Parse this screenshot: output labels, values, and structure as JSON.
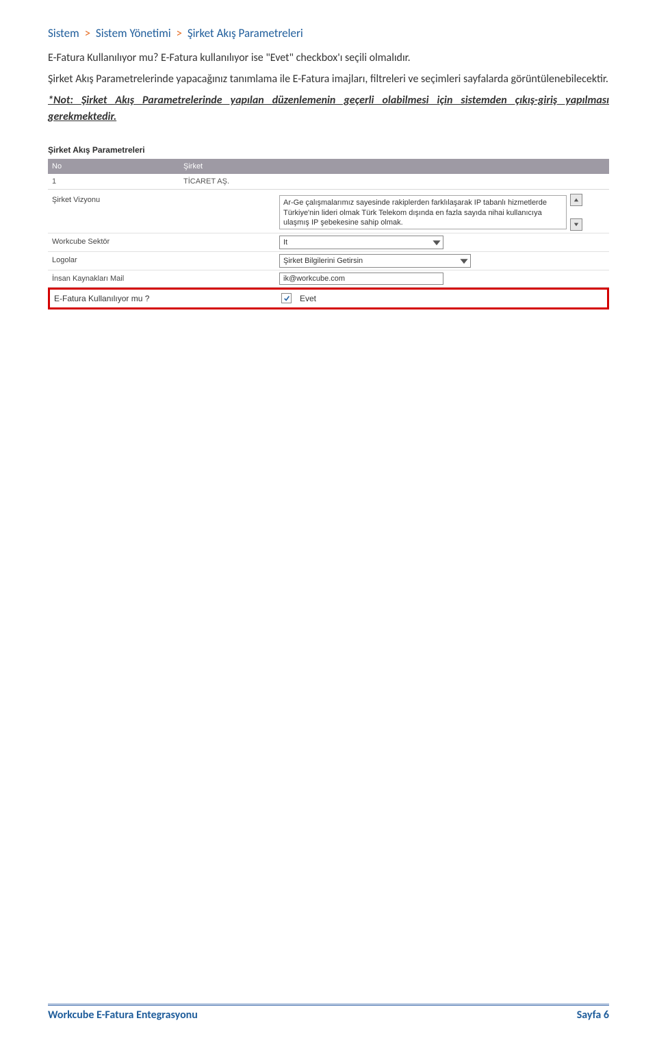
{
  "breadcrumb": {
    "seg1": "Sistem",
    "sep": ">",
    "seg2": "Sistem Yönetimi",
    "seg3": "Şirket Akış Parametreleri"
  },
  "paragraphs": {
    "p1": "E-Fatura Kullanılıyor mu? E-Fatura kullanılıyor ise \"Evet\" checkbox'ı seçili olmalıdır.",
    "p2": "Şirket Akış Parametrelerinde yapacağınız tanımlama ile E-Fatura imajları, filtreleri ve seçimleri sayfalarda görüntülenebilecektir.",
    "note": "*Not: Şirket Akış Parametrelerinde yapılan düzenlemenin geçerli olabilmesi için sistemden çıkış-giriş yapılması gerekmektedir."
  },
  "screenshot": {
    "title": "Şirket Akış Parametreleri",
    "headers": {
      "no": "No",
      "sirket": "Şirket"
    },
    "row1": {
      "no": "1",
      "sirket": "TİCARET AŞ."
    },
    "rows": {
      "vision_label": "Şirket Vizyonu",
      "vision_text": "Ar-Ge çalışmalarımız sayesinde rakiplerden farklılaşarak IP tabanlı hizmetlerde Türkiye'nin lideri olmak Türk Telekom dışında en fazla sayıda nihai kullanıcıya ulaşmış IP şebekesine sahip olmak.",
      "sector_label": "Workcube Sektör",
      "sector_value": "It",
      "logos_label": "Logolar",
      "logos_value": "Şirket Bilgilerini Getirsin",
      "hrmail_label": "İnsan Kaynakları Mail",
      "hrmail_value": "ik@workcube.com",
      "efat_label": "E-Fatura Kullanılıyor mu ?",
      "efat_checked": true,
      "efat_text": "Evet"
    }
  },
  "footer": {
    "left": "Workcube E-Fatura Entegrasyonu",
    "right": "Sayfa 6"
  }
}
